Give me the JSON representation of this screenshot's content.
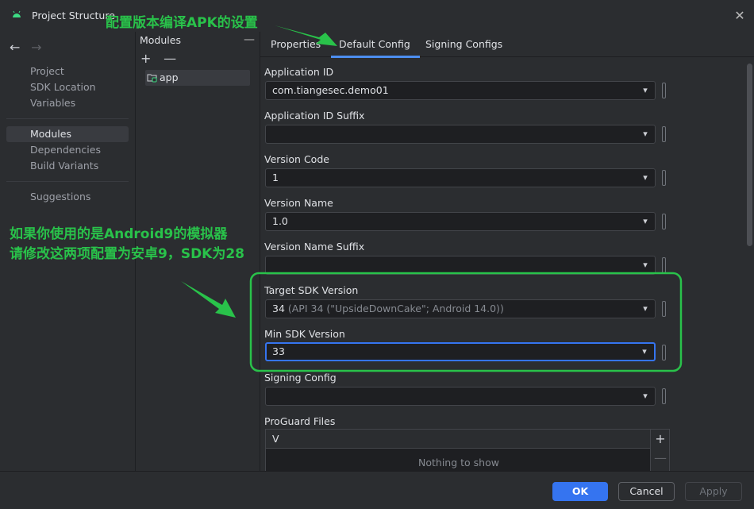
{
  "window": {
    "title": "Project Structure",
    "close_symbol": "✕"
  },
  "nav": {
    "back_arrow": "←",
    "forward_arrow": "→",
    "items": [
      {
        "label": "Project"
      },
      {
        "label": "SDK Location"
      },
      {
        "label": "Variables"
      },
      {
        "label": "Modules"
      },
      {
        "label": "Dependencies"
      },
      {
        "label": "Build Variants"
      },
      {
        "label": "Suggestions"
      }
    ],
    "selected": "Modules"
  },
  "modules_panel": {
    "header": "Modules",
    "minimize_symbol": "—",
    "add_symbol": "+",
    "remove_symbol": "—",
    "items": [
      {
        "label": "app"
      }
    ]
  },
  "tabs": [
    {
      "label": "Properties"
    },
    {
      "label": "Default Config"
    },
    {
      "label": "Signing Configs"
    }
  ],
  "active_tab": "Default Config",
  "fields": [
    {
      "label": "Application ID",
      "value": "com.tiangesec.demo01",
      "hint": ""
    },
    {
      "label": "Application ID Suffix",
      "value": "",
      "hint": ""
    },
    {
      "label": "Version Code",
      "value": "1",
      "hint": ""
    },
    {
      "label": "Version Name",
      "value": "1.0",
      "hint": ""
    },
    {
      "label": "Version Name Suffix",
      "value": "",
      "hint": ""
    },
    {
      "label": "Target SDK Version",
      "value": "34",
      "hint": " (API 34 (\"UpsideDownCake\"; Android 14.0))"
    },
    {
      "label": "Min SDK Version",
      "value": "33",
      "hint": ""
    },
    {
      "label": "Signing Config",
      "value": "",
      "hint": ""
    }
  ],
  "proguard": {
    "label": "ProGuard Files",
    "column_header": "V",
    "empty_text": "Nothing to show",
    "add_symbol": "+",
    "remove_symbol": "—"
  },
  "buttons": {
    "ok": "OK",
    "cancel": "Cancel",
    "apply": "Apply"
  },
  "annotations": {
    "top_note": "配置版本编译APK的设置",
    "left_note_line1": "如果你使用的是Android9的模拟器",
    "left_note_line2": "请修改这两项配置为安卓9，SDK为28",
    "highlight_color": "#29c24a"
  },
  "colors": {
    "background": "#2b2d30",
    "field_bg": "#1e1f22",
    "accent": "#3574f0",
    "tab_underline": "#4d8ef0",
    "annotation_green": "#29c24a"
  }
}
